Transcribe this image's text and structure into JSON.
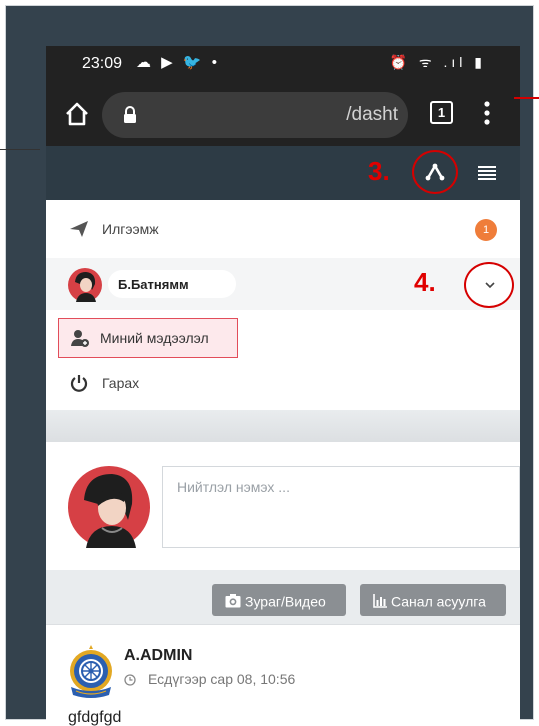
{
  "status_bar": {
    "time": "23:09",
    "left_icons": "☁ ▶ 🐦 •",
    "right_icons": "⏰ ᯤ .ıl ▮"
  },
  "browser": {
    "url": "/dasht",
    "tab_count": "1"
  },
  "annotations": {
    "step3": "3.",
    "step4": "4."
  },
  "menu": {
    "messages_label": "Илгээмж",
    "messages_badge": "1",
    "user_name": "Б.Батнямм",
    "profile_label": "Миний мэдээлэл",
    "logout_label": "Гарах"
  },
  "composer": {
    "placeholder": "Нийтлэл нэмэх ...",
    "media_button": "Зураг/Видео",
    "poll_button": "Санал асуулга"
  },
  "post": {
    "author": "A.ADMIN",
    "time": "Есдүгээр сар 08, 10:56",
    "body": "gfdgfgd"
  },
  "colors": {
    "accent_red": "#d50000",
    "badge_orange": "#ef7d3a",
    "appbar": "#2d3b45"
  }
}
